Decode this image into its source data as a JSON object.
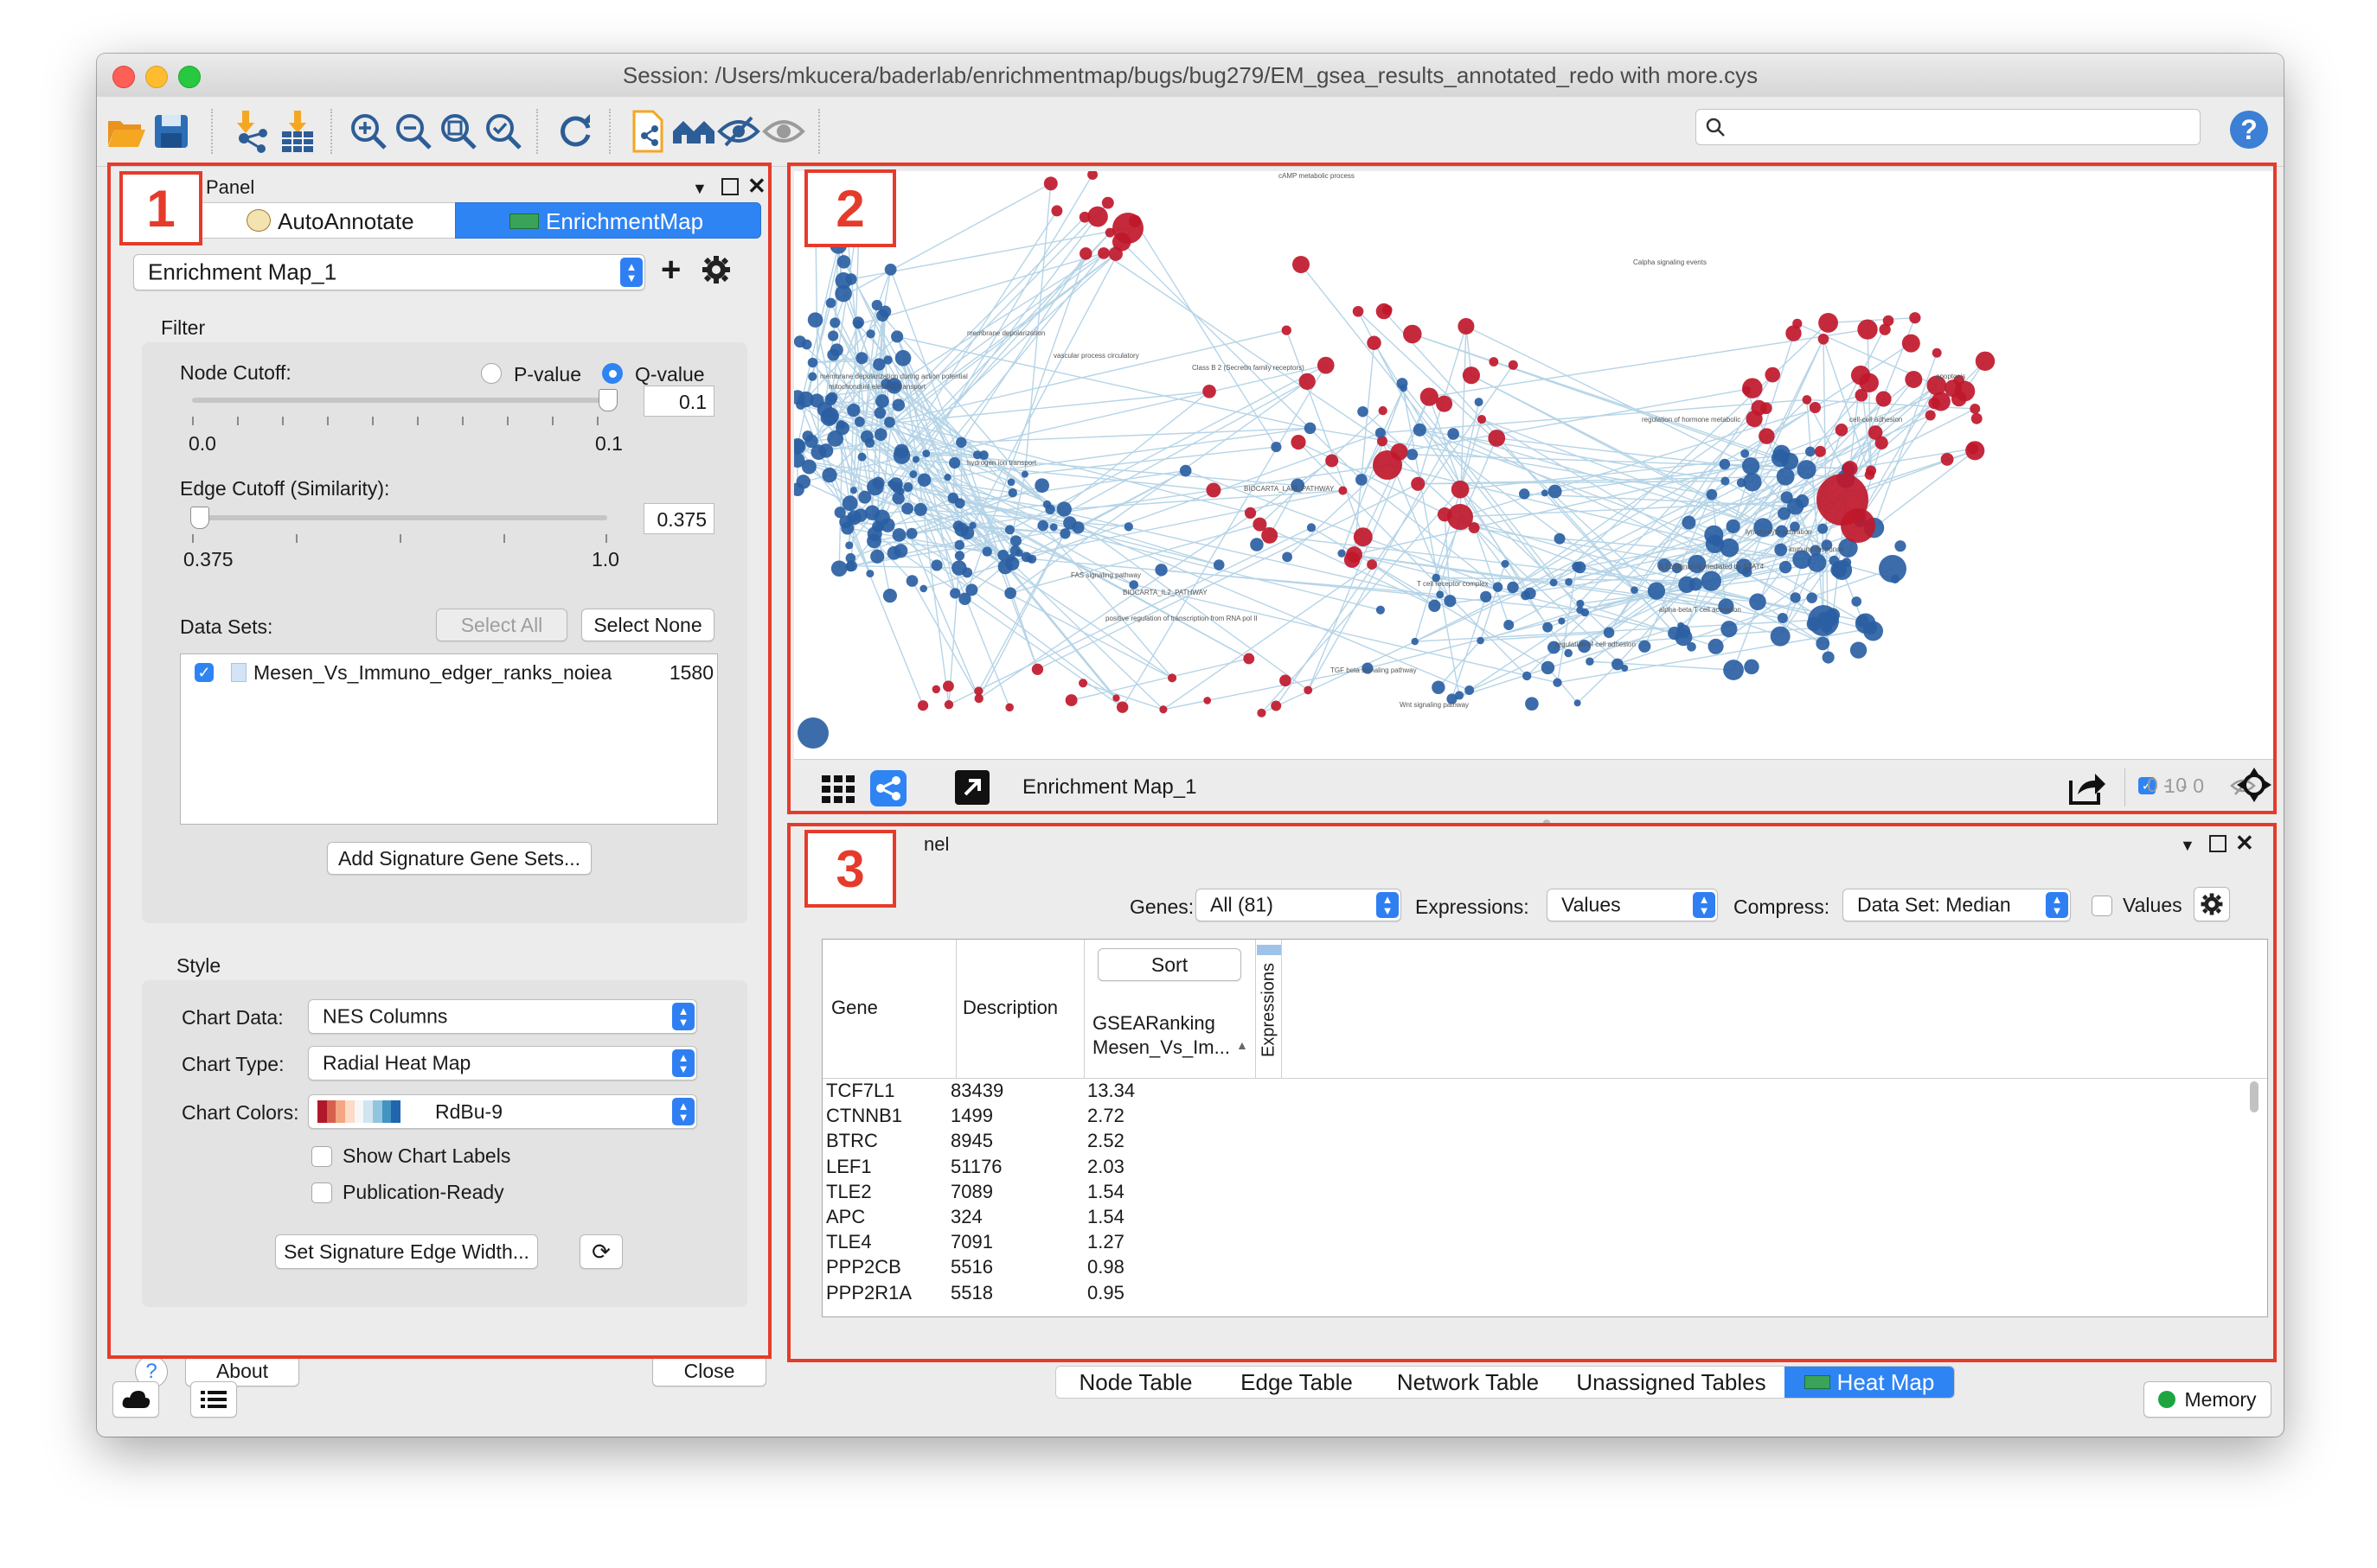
{
  "window": {
    "title": "Session: /Users/mkucera/baderlab/enrichmentmap/bugs/bug279/EM_gsea_results_annotated_redo with more.cys"
  },
  "toolbar": {
    "icons": [
      "folder-open-icon",
      "save-icon",
      "import-network-icon",
      "import-table-icon",
      "zoom-in-icon",
      "zoom-out-icon",
      "zoom-fit-icon",
      "zoom-selected-icon",
      "refresh-icon",
      "new-network-from-selection-icon",
      "first-neighbors-icon",
      "hide-icon",
      "show-icon"
    ],
    "search_placeholder": "",
    "help_label": "?"
  },
  "annotations": {
    "box1": "1",
    "box2": "2",
    "box3": "3"
  },
  "control_panel": {
    "title": "Panel",
    "tabs": [
      {
        "label": "AutoAnnotate",
        "selected": false
      },
      {
        "label": "EnrichmentMap",
        "selected": true
      }
    ],
    "network_select": "Enrichment Map_1",
    "filter": {
      "heading": "Filter",
      "node_cutoff_label": "Node Cutoff:",
      "pvalue_label": "P-value",
      "qvalue_label": "Q-value",
      "selected_cutoff": "Q-value",
      "node_cutoff_value": "0.1",
      "node_min": "0.0",
      "node_max": "0.1",
      "node_slider_position": 1.0,
      "edge_cutoff_label": "Edge Cutoff (Similarity):",
      "edge_cutoff_value": "0.375",
      "edge_min": "0.375",
      "edge_max": "1.0",
      "edge_slider_position": 0.0,
      "datasets_label": "Data Sets:",
      "select_all": "Select All",
      "select_none": "Select None",
      "datasets": [
        {
          "name": "Mesen_Vs_Immuno_edger_ranks_noiea",
          "count": "1580",
          "checked": true
        }
      ],
      "add_signature": "Add Signature Gene Sets..."
    },
    "style": {
      "heading": "Style",
      "chart_data_label": "Chart Data:",
      "chart_data_value": "NES Columns",
      "chart_type_label": "Chart Type:",
      "chart_type_value": "Radial Heat Map",
      "chart_colors_label": "Chart Colors:",
      "chart_colors_value": "RdBu-9",
      "palette": [
        "#b2182b",
        "#d6604d",
        "#f4a582",
        "#fddbc7",
        "#f7f7f7",
        "#d1e5f0",
        "#92c5de",
        "#4393c3",
        "#2166ac"
      ],
      "show_chart_labels": "Show Chart Labels",
      "publication_ready": "Publication-Ready",
      "set_signature_edge": "Set Signature Edge Width..."
    },
    "footer": {
      "help": "?",
      "about": "About",
      "close": "Close"
    }
  },
  "network_view": {
    "name": "Enrichment Map_1",
    "selected_count": "1 - 0",
    "hidden_count": "0 - 0",
    "colors": {
      "red_node": "#c0182b",
      "blue_node": "#2b5fa3",
      "edge": "#a9cde3"
    },
    "labels": [
      "cAMP metabolic process",
      "Calpha signaling events",
      "membrane depolarization",
      "vascular process circulatory",
      "Class B 2 (Secretin family receptors)",
      "membrane depolarization during action potential",
      "mitochondrial electron transport",
      "hydrogen ion transport",
      "FAS signaling pathway",
      "BIOCARTA_LAIR_PATHWAY",
      "BIOCARTA_IL2_PATHWAY",
      "T cell receptor complex",
      "lymphocyte activation",
      "immune response",
      "regulation of hormone metabolic",
      "cell-cell adhesion",
      "apoptosis",
      "IL12 signaling mediated by STAT4",
      "alpha-beta T cell activation",
      "regulation of cell adhesion",
      "positive regulation of transcription from RNA pol II",
      "TGF beta signaling pathway",
      "Wnt signaling pathway"
    ]
  },
  "table_panel": {
    "title": "nel",
    "genes_label": "Genes:",
    "genes_value": "All (81)",
    "expressions_label": "Expressions:",
    "expressions_value": "Values",
    "compress_label": "Compress:",
    "compress_value": "Data Set: Median",
    "values_checkbox": "Values",
    "sort_button": "Sort",
    "columns": {
      "gene": "Gene",
      "description": "Description",
      "ranking_line1": "GSEARanking",
      "ranking_line2": "Mesen_Vs_Im...",
      "expressions": "Expressions"
    },
    "rows": [
      {
        "gene": "TCF7L1",
        "description": "83439",
        "rank": "13.34"
      },
      {
        "gene": "CTNNB1",
        "description": "1499",
        "rank": "2.72"
      },
      {
        "gene": "BTRC",
        "description": "8945",
        "rank": "2.52"
      },
      {
        "gene": "LEF1",
        "description": "51176",
        "rank": "2.03"
      },
      {
        "gene": "TLE2",
        "description": "7089",
        "rank": "1.54"
      },
      {
        "gene": "APC",
        "description": "324",
        "rank": "1.54"
      },
      {
        "gene": "TLE4",
        "description": "7091",
        "rank": "1.27"
      },
      {
        "gene": "PPP2CB",
        "description": "5516",
        "rank": "0.98"
      },
      {
        "gene": "PPP2R1A",
        "description": "5518",
        "rank": "0.95"
      }
    ],
    "tabs": [
      {
        "label": "Node Table",
        "selected": false
      },
      {
        "label": "Edge Table",
        "selected": false
      },
      {
        "label": "Network Table",
        "selected": false
      },
      {
        "label": "Unassigned Tables",
        "selected": false
      },
      {
        "label": "Heat Map",
        "selected": true
      }
    ]
  },
  "statusbar": {
    "memory": "Memory",
    "memory_color": "#1ea542"
  }
}
